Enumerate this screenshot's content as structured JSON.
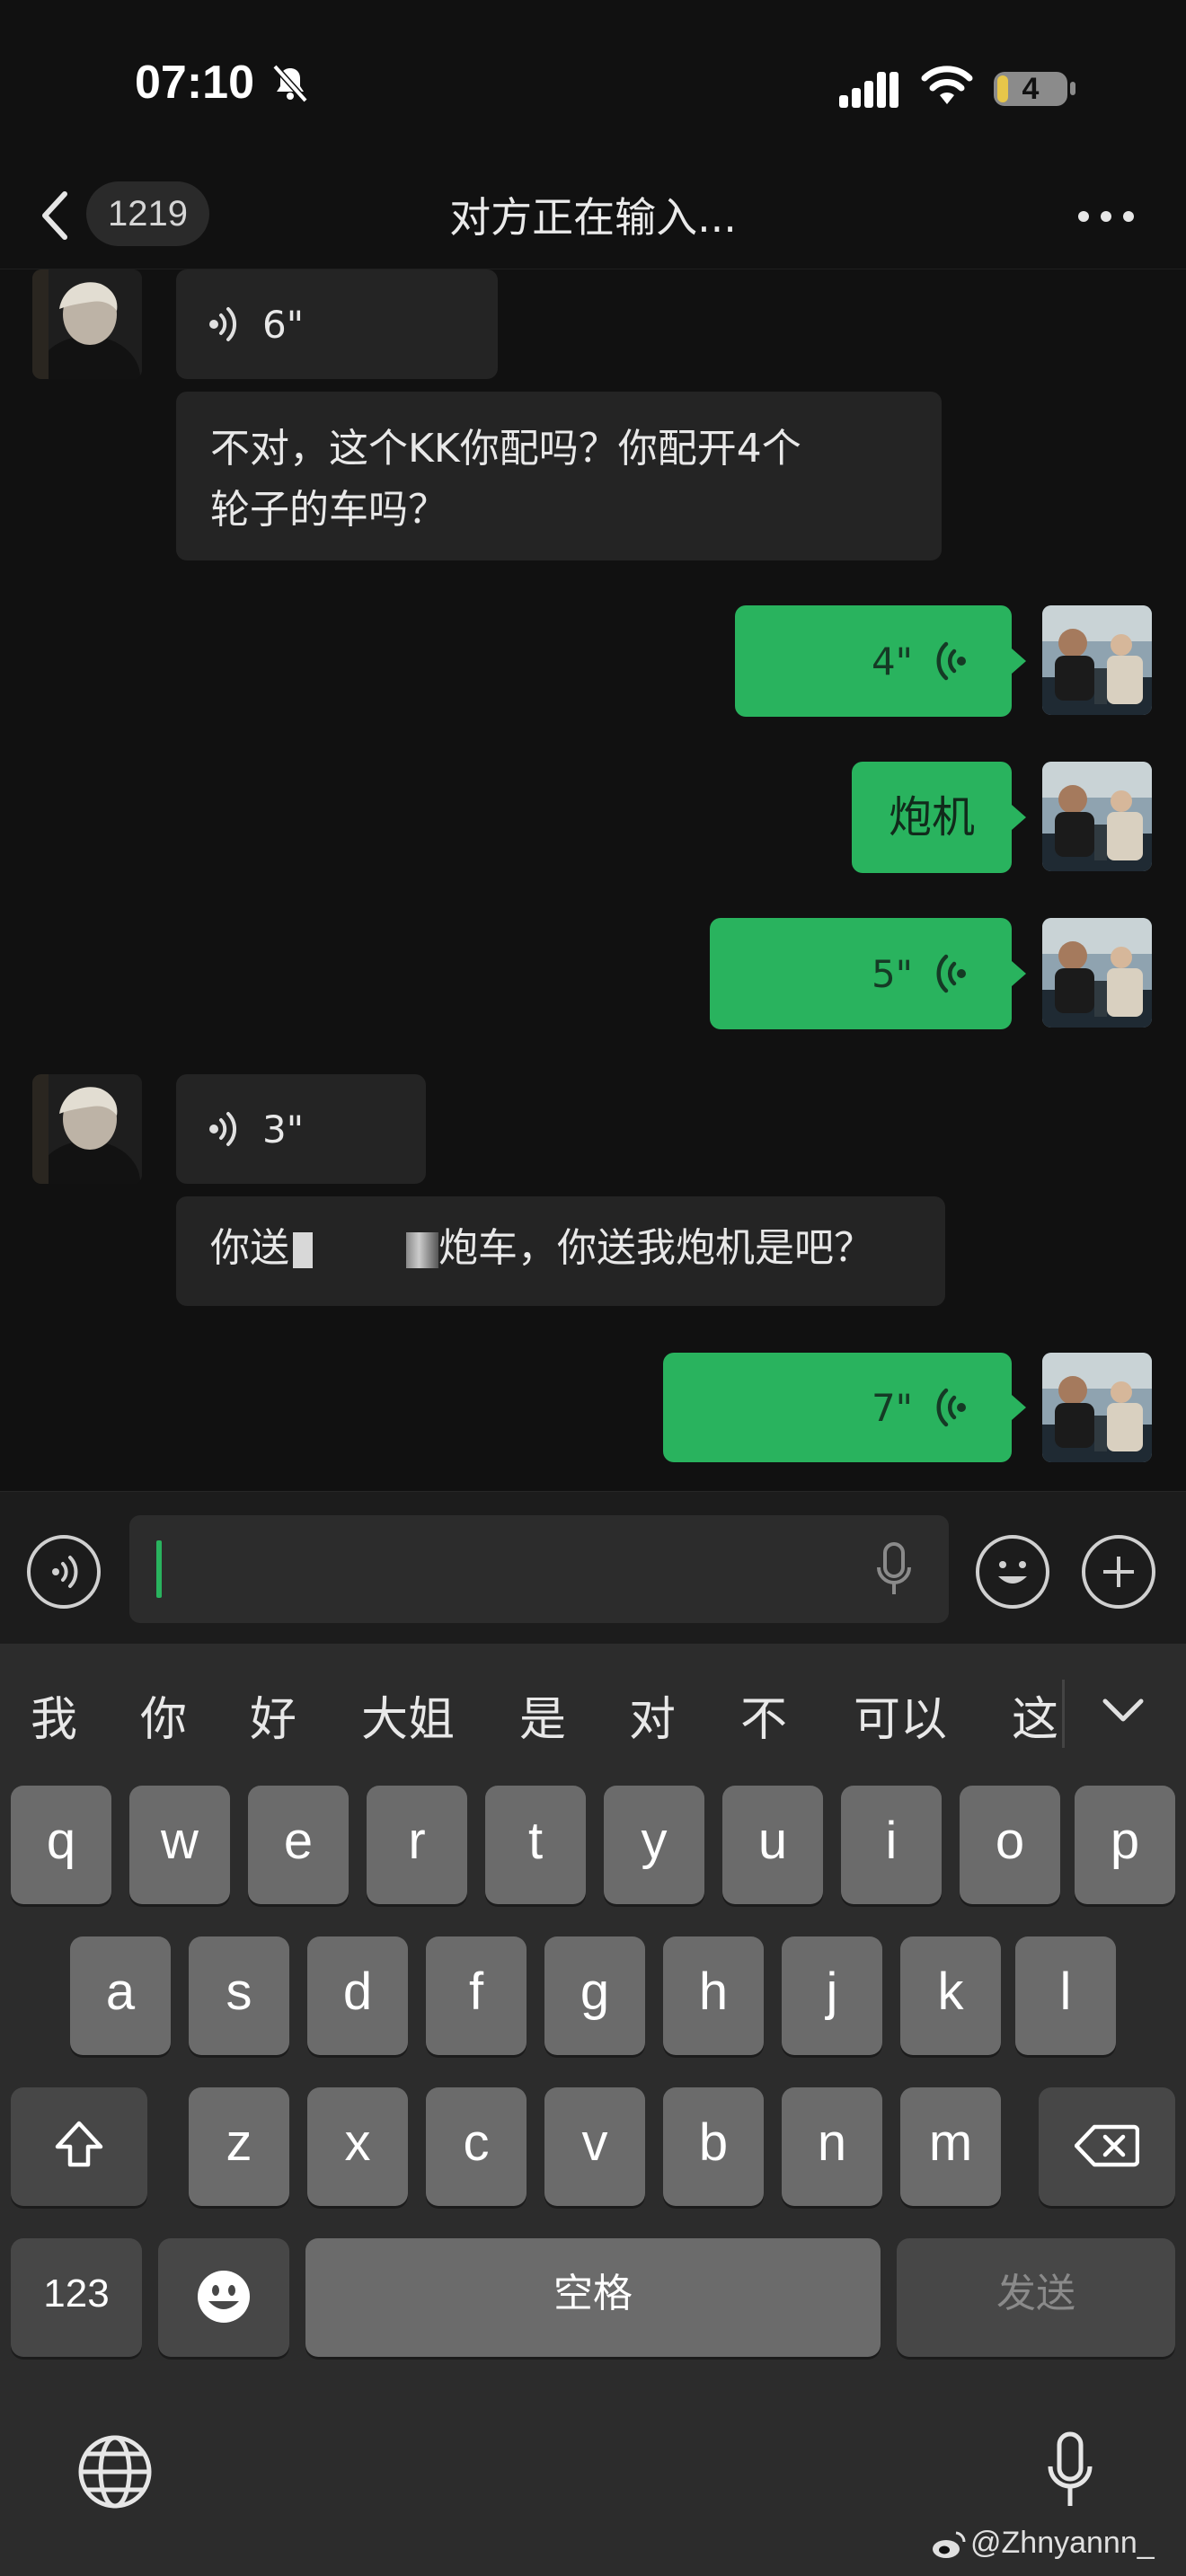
{
  "status": {
    "time": "07:10",
    "battery": "4",
    "icons": [
      "bell-slash-icon",
      "signal-icon",
      "wifi-icon",
      "battery-icon"
    ]
  },
  "nav": {
    "unread_count": "1219",
    "title": "对方正在输入...",
    "icons": [
      "back-chevron-icon",
      "more-icon"
    ]
  },
  "messages": [
    {
      "side": "in",
      "type": "voice",
      "duration": "6\""
    },
    {
      "side": "in",
      "type": "text",
      "lines": [
        "不对，这个KK你配吗？你配开4个",
        "轮子的车吗？"
      ]
    },
    {
      "side": "out",
      "type": "voice",
      "duration": "4\""
    },
    {
      "side": "out",
      "type": "text",
      "text": "炮机"
    },
    {
      "side": "out",
      "type": "voice",
      "duration": "5\""
    },
    {
      "side": "in",
      "type": "voice",
      "duration": "3\""
    },
    {
      "side": "in",
      "type": "text",
      "prefix": "你送",
      "suffix": "炮车，你送我炮机是吧？"
    },
    {
      "side": "out",
      "type": "voice",
      "duration": "7\""
    }
  ],
  "input": {
    "value": "",
    "icons": [
      "voice-mode-icon",
      "mic-icon",
      "emoji-icon",
      "plus-icon"
    ]
  },
  "keyboard": {
    "candidates": [
      "我",
      "你",
      "好",
      "大姐",
      "是",
      "对",
      "不",
      "可以",
      "这"
    ],
    "row1": [
      "q",
      "w",
      "e",
      "r",
      "t",
      "y",
      "u",
      "i",
      "o",
      "p"
    ],
    "row2": [
      "a",
      "s",
      "d",
      "f",
      "g",
      "h",
      "j",
      "k",
      "l"
    ],
    "row3": [
      "z",
      "x",
      "c",
      "v",
      "b",
      "n",
      "m"
    ],
    "numbers_key": "123",
    "space_key": "空格",
    "send_key": "发送",
    "icons": [
      "shift-icon",
      "backspace-icon",
      "emoji-key-icon",
      "globe-icon",
      "dictation-mic-icon",
      "collapse-chevron-icon"
    ]
  },
  "watermark": "@Zhnyannn_",
  "colors": {
    "background": "#111111",
    "outgoing_bubble": "#29b35e",
    "incoming_bubble": "#242424",
    "keyboard": "#2c2c2c"
  }
}
